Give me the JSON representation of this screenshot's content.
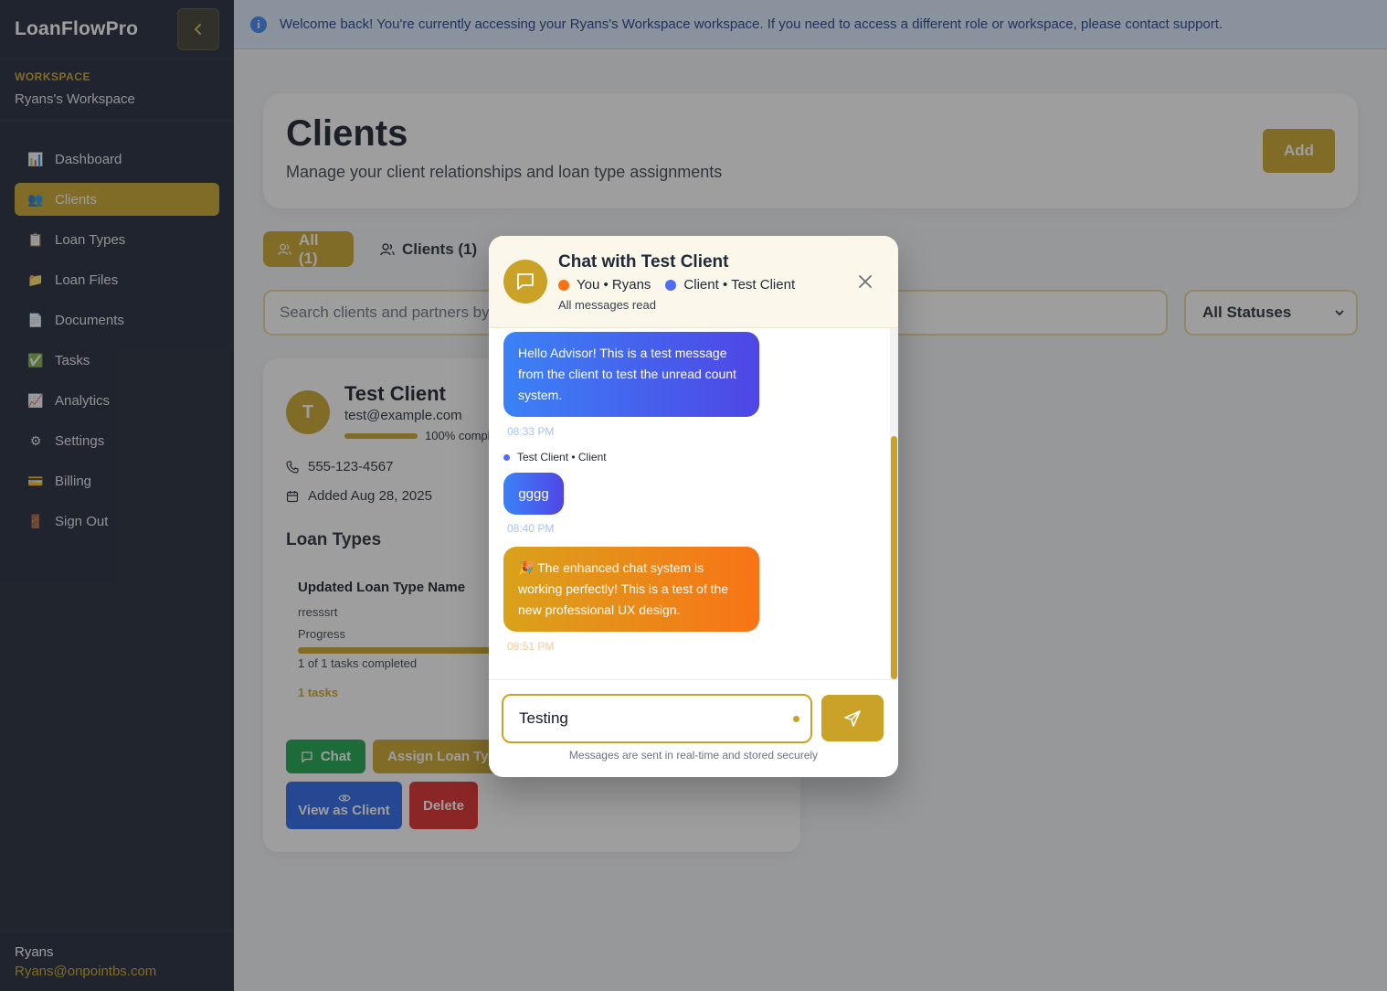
{
  "app": {
    "brand": "LoanFlowPro"
  },
  "sidebar": {
    "workspace_label": "WORKSPACE",
    "workspace_name": "Ryans's Workspace",
    "items": [
      {
        "label": "Dashboard",
        "icon": "bar-chart-icon"
      },
      {
        "label": "Clients",
        "icon": "users-icon",
        "active": true
      },
      {
        "label": "Loan Types",
        "icon": "clipboard-icon"
      },
      {
        "label": "Loan Files",
        "icon": "folder-icon"
      },
      {
        "label": "Documents",
        "icon": "document-icon"
      },
      {
        "label": "Tasks",
        "icon": "checkbox-icon"
      },
      {
        "label": "Analytics",
        "icon": "line-chart-icon"
      },
      {
        "label": "Settings",
        "icon": "gear-icon"
      },
      {
        "label": "Billing",
        "icon": "credit-card-icon"
      },
      {
        "label": "Sign Out",
        "icon": "door-icon"
      }
    ],
    "user_name": "Ryans",
    "user_email": "Ryans@onpointbs.com"
  },
  "banner": {
    "text": "Welcome back! You're currently accessing your Ryans's Workspace workspace. If you need to access a different role or workspace, please contact support."
  },
  "page": {
    "title": "Clients",
    "subtitle": "Manage your client relationships and loan type assignments",
    "add_label": "Add",
    "tabs": [
      {
        "label": "All (1)",
        "active": true
      },
      {
        "label": "Clients (1)"
      }
    ],
    "search_placeholder": "Search clients and partners by",
    "status_filter": "All Statuses"
  },
  "client": {
    "initial": "T",
    "name": "Test Client",
    "email": "test@example.com",
    "completion_pct": 100,
    "completion_text": "100% compl",
    "phone": "555-123-4567",
    "added": "Added Aug 28, 2025",
    "loan_types_heading": "Loan Types",
    "loan_type": {
      "name": "Updated Loan Type Name",
      "description": "rresssrt",
      "progress_label": "Progress",
      "progress_pct": 100,
      "tasks_completed": "1 of 1 tasks completed",
      "tasks_count": "1 tasks"
    },
    "buttons": {
      "chat": "Chat",
      "assign": "Assign Loan Typ",
      "view_as_client": "View as Client",
      "delete": "Delete"
    }
  },
  "chat": {
    "title": "Chat with Test Client",
    "you_label": "You • Ryans",
    "client_label": "Client • Test Client",
    "read_status": "All messages read",
    "colors": {
      "you": "#f97316",
      "client": "#4f6ef7",
      "accent": "#c9a227"
    },
    "messages": [
      {
        "text": "Hello Advisor! This is a test message from the client to test the unread count system.",
        "time": "08:33 PM"
      },
      {
        "sender": "Test Client • Client",
        "text": "gggg",
        "time": "08:40 PM"
      },
      {
        "text": "🎉 The enhanced chat system is working perfectly! This is a test of the new professional UX design.",
        "time": "08:51 PM"
      }
    ],
    "input_value": "Testing",
    "footer_note": "Messages are sent in real-time and stored securely"
  }
}
